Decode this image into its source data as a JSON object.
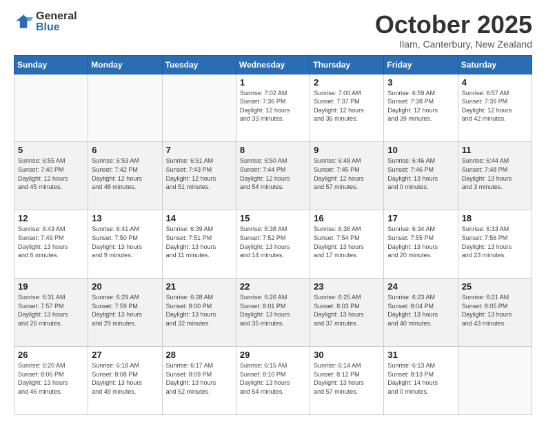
{
  "logo": {
    "general": "General",
    "blue": "Blue"
  },
  "header": {
    "month": "October 2025",
    "location": "Ilam, Canterbury, New Zealand"
  },
  "weekdays": [
    "Sunday",
    "Monday",
    "Tuesday",
    "Wednesday",
    "Thursday",
    "Friday",
    "Saturday"
  ],
  "weeks": [
    [
      {
        "day": "",
        "info": ""
      },
      {
        "day": "",
        "info": ""
      },
      {
        "day": "",
        "info": ""
      },
      {
        "day": "1",
        "info": "Sunrise: 7:02 AM\nSunset: 7:36 PM\nDaylight: 12 hours\nand 33 minutes."
      },
      {
        "day": "2",
        "info": "Sunrise: 7:00 AM\nSunset: 7:37 PM\nDaylight: 12 hours\nand 36 minutes."
      },
      {
        "day": "3",
        "info": "Sunrise: 6:59 AM\nSunset: 7:38 PM\nDaylight: 12 hours\nand 39 minutes."
      },
      {
        "day": "4",
        "info": "Sunrise: 6:57 AM\nSunset: 7:39 PM\nDaylight: 12 hours\nand 42 minutes."
      }
    ],
    [
      {
        "day": "5",
        "info": "Sunrise: 6:55 AM\nSunset: 7:40 PM\nDaylight: 12 hours\nand 45 minutes."
      },
      {
        "day": "6",
        "info": "Sunrise: 6:53 AM\nSunset: 7:42 PM\nDaylight: 12 hours\nand 48 minutes."
      },
      {
        "day": "7",
        "info": "Sunrise: 6:51 AM\nSunset: 7:43 PM\nDaylight: 12 hours\nand 51 minutes."
      },
      {
        "day": "8",
        "info": "Sunrise: 6:50 AM\nSunset: 7:44 PM\nDaylight: 12 hours\nand 54 minutes."
      },
      {
        "day": "9",
        "info": "Sunrise: 6:48 AM\nSunset: 7:45 PM\nDaylight: 12 hours\nand 57 minutes."
      },
      {
        "day": "10",
        "info": "Sunrise: 6:46 AM\nSunset: 7:46 PM\nDaylight: 13 hours\nand 0 minutes."
      },
      {
        "day": "11",
        "info": "Sunrise: 6:44 AM\nSunset: 7:48 PM\nDaylight: 13 hours\nand 3 minutes."
      }
    ],
    [
      {
        "day": "12",
        "info": "Sunrise: 6:43 AM\nSunset: 7:49 PM\nDaylight: 13 hours\nand 6 minutes."
      },
      {
        "day": "13",
        "info": "Sunrise: 6:41 AM\nSunset: 7:50 PM\nDaylight: 13 hours\nand 9 minutes."
      },
      {
        "day": "14",
        "info": "Sunrise: 6:39 AM\nSunset: 7:51 PM\nDaylight: 13 hours\nand 11 minutes."
      },
      {
        "day": "15",
        "info": "Sunrise: 6:38 AM\nSunset: 7:52 PM\nDaylight: 13 hours\nand 14 minutes."
      },
      {
        "day": "16",
        "info": "Sunrise: 6:36 AM\nSunset: 7:54 PM\nDaylight: 13 hours\nand 17 minutes."
      },
      {
        "day": "17",
        "info": "Sunrise: 6:34 AM\nSunset: 7:55 PM\nDaylight: 13 hours\nand 20 minutes."
      },
      {
        "day": "18",
        "info": "Sunrise: 6:33 AM\nSunset: 7:56 PM\nDaylight: 13 hours\nand 23 minutes."
      }
    ],
    [
      {
        "day": "19",
        "info": "Sunrise: 6:31 AM\nSunset: 7:57 PM\nDaylight: 13 hours\nand 26 minutes."
      },
      {
        "day": "20",
        "info": "Sunrise: 6:29 AM\nSunset: 7:59 PM\nDaylight: 13 hours\nand 29 minutes."
      },
      {
        "day": "21",
        "info": "Sunrise: 6:28 AM\nSunset: 8:00 PM\nDaylight: 13 hours\nand 32 minutes."
      },
      {
        "day": "22",
        "info": "Sunrise: 6:26 AM\nSunset: 8:01 PM\nDaylight: 13 hours\nand 35 minutes."
      },
      {
        "day": "23",
        "info": "Sunrise: 6:25 AM\nSunset: 8:03 PM\nDaylight: 13 hours\nand 37 minutes."
      },
      {
        "day": "24",
        "info": "Sunrise: 6:23 AM\nSunset: 8:04 PM\nDaylight: 13 hours\nand 40 minutes."
      },
      {
        "day": "25",
        "info": "Sunrise: 6:21 AM\nSunset: 8:05 PM\nDaylight: 13 hours\nand 43 minutes."
      }
    ],
    [
      {
        "day": "26",
        "info": "Sunrise: 6:20 AM\nSunset: 8:06 PM\nDaylight: 13 hours\nand 46 minutes."
      },
      {
        "day": "27",
        "info": "Sunrise: 6:18 AM\nSunset: 8:08 PM\nDaylight: 13 hours\nand 49 minutes."
      },
      {
        "day": "28",
        "info": "Sunrise: 6:17 AM\nSunset: 8:09 PM\nDaylight: 13 hours\nand 52 minutes."
      },
      {
        "day": "29",
        "info": "Sunrise: 6:15 AM\nSunset: 8:10 PM\nDaylight: 13 hours\nand 54 minutes."
      },
      {
        "day": "30",
        "info": "Sunrise: 6:14 AM\nSunset: 8:12 PM\nDaylight: 13 hours\nand 57 minutes."
      },
      {
        "day": "31",
        "info": "Sunrise: 6:13 AM\nSunset: 8:13 PM\nDaylight: 14 hours\nand 0 minutes."
      },
      {
        "day": "",
        "info": ""
      }
    ]
  ]
}
